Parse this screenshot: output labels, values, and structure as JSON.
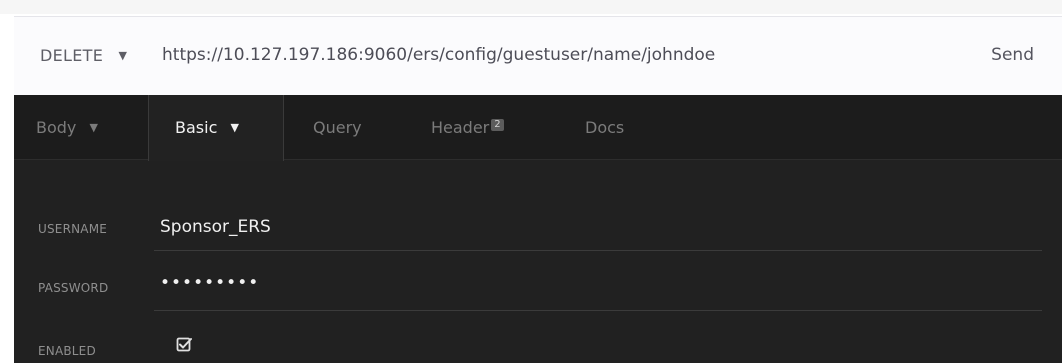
{
  "request": {
    "method": "DELETE",
    "url": "https://10.127.197.186:9060/ers/config/guestuser/name/johndoe",
    "send_label": "Send"
  },
  "tabs": {
    "body": "Body",
    "basic": "Basic",
    "query": "Query",
    "header": "Header",
    "header_count": "2",
    "docs": "Docs"
  },
  "auth": {
    "username_label": "USERNAME",
    "username_value": "Sponsor_ERS",
    "password_label": "PASSWORD",
    "password_value": "•••••••••",
    "enabled_label": "ENABLED",
    "enabled_checked": true
  },
  "icons": {
    "method_caret": "chevron-down-icon",
    "body_caret": "chevron-down-icon",
    "basic_caret": "chevron-down-icon",
    "enabled_checkbox": "checkbox-checked-icon"
  },
  "colors": {
    "panel_bg": "#212121",
    "tabbar_bg": "#1c1c1c",
    "active_tab_text": "#f2f2f2",
    "inactive_tab_text": "#7b7b7b",
    "url_text": "#4d4d57"
  }
}
